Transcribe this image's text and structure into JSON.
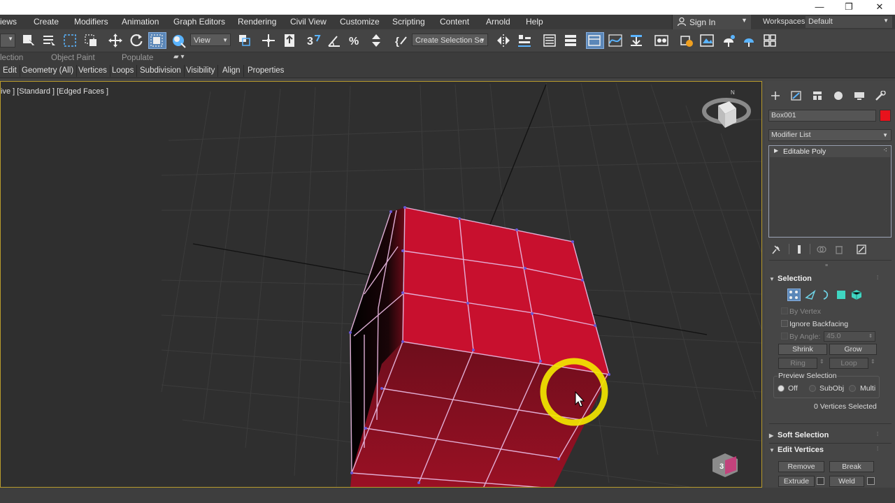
{
  "window": {
    "minimize": "—",
    "maximize": "❐",
    "close": "✕"
  },
  "menu": {
    "items": [
      "iews",
      "Create",
      "Modifiers",
      "Animation",
      "Graph Editors",
      "Rendering",
      "Civil View",
      "Customize",
      "Scripting",
      "Content",
      "Arnold",
      "Help"
    ],
    "sign_in": "Sign In",
    "workspaces_label": "Workspaces:",
    "workspaces_value": "Default"
  },
  "toolbar": {
    "view_dropdown": "View",
    "selection_set": "Create Selection Se"
  },
  "ribbon": {
    "tabs": [
      "lection",
      "Object Paint",
      "Populate"
    ],
    "buttons": [
      "Edit",
      "Geometry (All)",
      "Vertices",
      "Loops",
      "Subdivision",
      "Visibility",
      "Align",
      "Properties"
    ]
  },
  "viewport": {
    "label": "ive ] [Standard ] [Edged Faces ]",
    "object_color": "#c8102e",
    "highlight_color": "#f2e600"
  },
  "command_panel": {
    "object_name": "Box001",
    "object_color": "#e8121c",
    "modifier_list": "Modifier List",
    "stack_item": "Editable Poly",
    "selection": {
      "title": "Selection",
      "by_vertex": "By Vertex",
      "ignore_backfacing": "Ignore Backfacing",
      "by_angle": "By Angle:",
      "angle_value": "45.0",
      "shrink": "Shrink",
      "grow": "Grow",
      "ring": "Ring",
      "loop": "Loop",
      "preview_selection": "Preview Selection",
      "off": "Off",
      "subobj": "SubObj",
      "multi": "Multi",
      "status": "0 Vertices Selected"
    },
    "soft_selection": "Soft Selection",
    "edit_vertices": {
      "title": "Edit Vertices",
      "remove": "Remove",
      "break": "Break",
      "extrude": "Extrude",
      "weld": "Weld"
    }
  }
}
